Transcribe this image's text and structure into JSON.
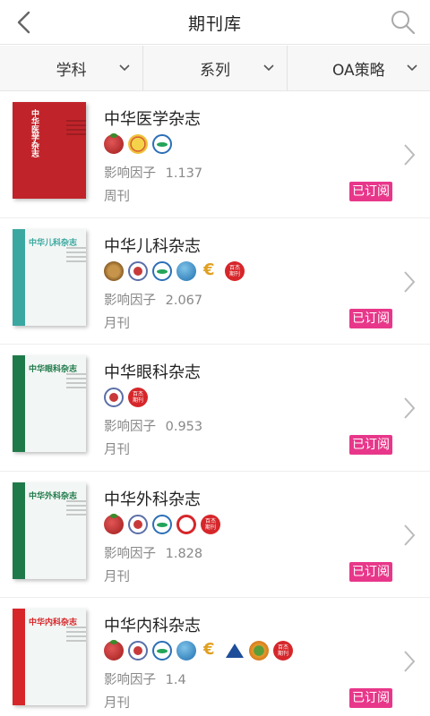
{
  "header": {
    "title": "期刊库",
    "back_icon": "chevron-left-icon",
    "search_icon": "search-icon"
  },
  "filters": [
    {
      "label": "学科"
    },
    {
      "label": "系列"
    },
    {
      "label": "OA策略"
    }
  ],
  "colors": {
    "subscribe_bg": "#e8378a",
    "divider": "#e6e6e6"
  },
  "journals": [
    {
      "name": "中华医学杂志",
      "impact_label": "影响因子",
      "impact_value": "1.137",
      "frequency": "周刊",
      "status": "已订阅",
      "cover_color": "#c0242a",
      "cover_title": "中华医学杂志",
      "badges": [
        "red-tomato",
        "gold-seal",
        "blue-eye"
      ]
    },
    {
      "name": "中华儿科杂志",
      "impact_label": "影响因子",
      "impact_value": "2.067",
      "frequency": "月刊",
      "status": "已订阅",
      "cover_color": "#3aa8a0",
      "cover_title": "中华儿科杂志",
      "badges": [
        "bronze",
        "star-seal",
        "blue-eye",
        "blue-globe",
        "euro",
        "red-label"
      ]
    },
    {
      "name": "中华眼科杂志",
      "impact_label": "影响因子",
      "impact_value": "0.953",
      "frequency": "月刊",
      "status": "已订阅",
      "cover_color": "#1f7a4a",
      "cover_title": "中华眼科杂志",
      "badges": [
        "star-seal",
        "red-label"
      ]
    },
    {
      "name": "中华外科杂志",
      "impact_label": "影响因子",
      "impact_value": "1.828",
      "frequency": "月刊",
      "status": "已订阅",
      "cover_color": "#1f7a4a",
      "cover_title": "中华外科杂志",
      "badges": [
        "red-tomato",
        "star-seal",
        "blue-eye",
        "red-spiral",
        "red-label"
      ]
    },
    {
      "name": "中华内科杂志",
      "impact_label": "影响因子",
      "impact_value": "1.4",
      "frequency": "月刊",
      "status": "已订阅",
      "cover_color": "#d6262a",
      "cover_title": "中华内科杂志",
      "badges": [
        "red-tomato",
        "star-seal",
        "blue-eye",
        "blue-globe",
        "euro",
        "blue-tri",
        "orange-gear",
        "red-label"
      ]
    }
  ]
}
